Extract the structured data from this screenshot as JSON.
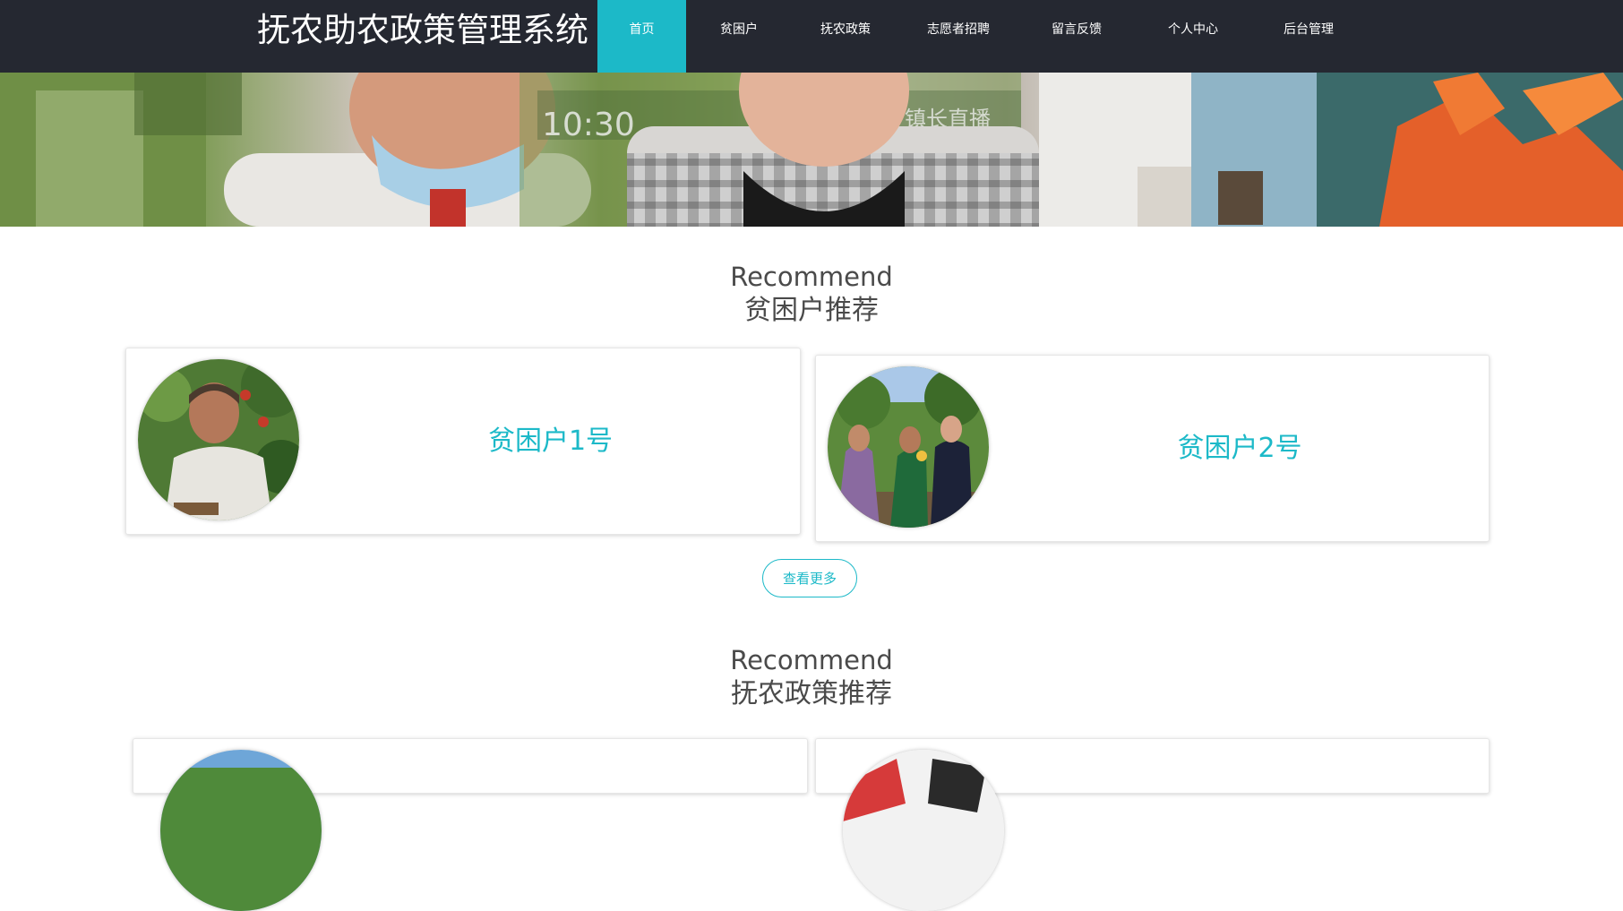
{
  "header": {
    "title": "抚农助农政策管理系统",
    "nav": [
      {
        "label": "首页",
        "active": true
      },
      {
        "label": "贫困户",
        "active": false
      },
      {
        "label": "抚农政策",
        "active": false
      },
      {
        "label": "志愿者招聘",
        "active": false
      },
      {
        "label": "留言反馈",
        "active": false
      },
      {
        "label": "个人中心",
        "active": false
      },
      {
        "label": "后台管理",
        "active": false
      }
    ]
  },
  "banner": {
    "overlay_text": [
      "10:30",
      "镇长直播"
    ]
  },
  "sections": [
    {
      "title_en": "Recommend",
      "title_cn": "贫困户推荐",
      "cards": [
        {
          "name": "贫困户1号"
        },
        {
          "name": "贫困户2号"
        }
      ],
      "more_label": "查看更多"
    },
    {
      "title_en": "Recommend",
      "title_cn": "抚农政策推荐"
    }
  ],
  "colors": {
    "accent": "#1cb9c8",
    "header_bg": "#252831"
  }
}
